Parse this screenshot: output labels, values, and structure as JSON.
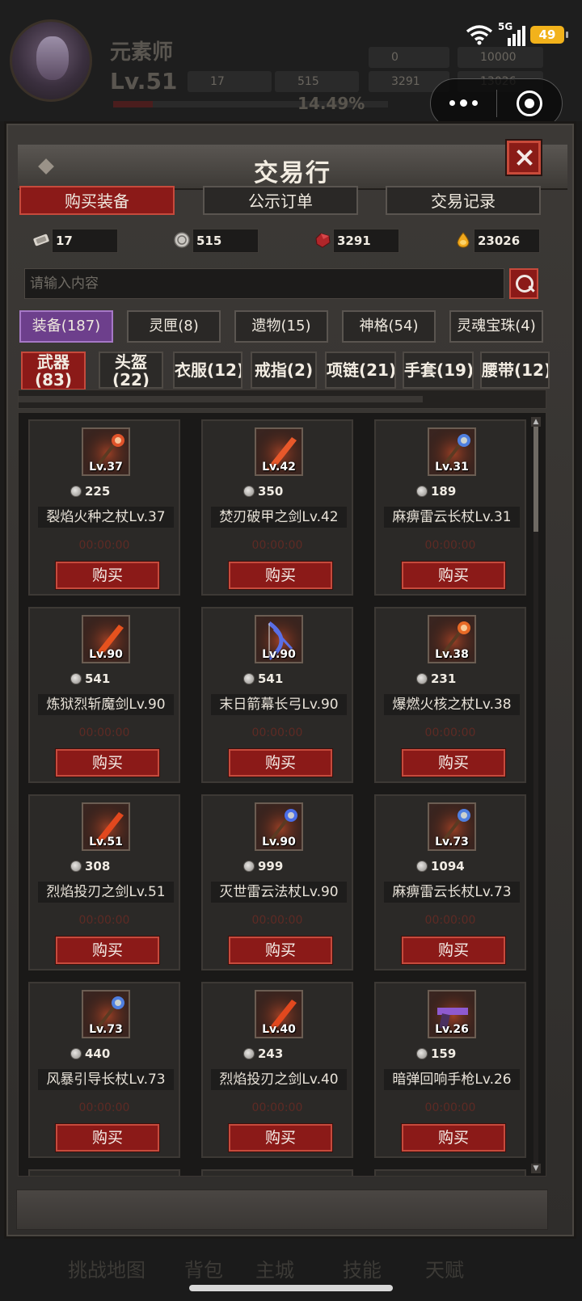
{
  "background_hud": {
    "player_name": "元素师",
    "level": "Lv.51",
    "stat_tickets": "17",
    "stat_silver": "515",
    "stat_red_a": "0",
    "stat_red_b": "3291",
    "stat_gold_a": "10000",
    "stat_gold_b": "13026",
    "exp_percent": "14.49%",
    "exp_fraction": 0.1449,
    "bottom_nav": [
      "挑战地图",
      "背包",
      "主城",
      "技能",
      "天赋"
    ]
  },
  "status_bar": {
    "network": "5G",
    "battery": "49"
  },
  "panel": {
    "title": "交易行",
    "tabs": [
      {
        "label": "购买装备",
        "active": true
      },
      {
        "label": "公示订单",
        "active": false
      },
      {
        "label": "交易记录",
        "active": false
      }
    ],
    "currencies": [
      {
        "icon": "ticket-icon",
        "value": "17"
      },
      {
        "icon": "silver-coin-icon",
        "value": "515"
      },
      {
        "icon": "red-crystal-icon",
        "value": "3291"
      },
      {
        "icon": "gold-ingot-icon",
        "value": "23026"
      }
    ],
    "search": {
      "placeholder": "请输入内容"
    },
    "categories": [
      {
        "label": "装备(187)",
        "active": true
      },
      {
        "label": "灵匣(8)",
        "active": false
      },
      {
        "label": "遗物(15)",
        "active": false
      },
      {
        "label": "神格(54)",
        "active": false
      },
      {
        "label": "灵魂宝珠(4)",
        "active": false
      }
    ],
    "subcategories": [
      {
        "line1": "武器",
        "line2": "(83)",
        "active": true
      },
      {
        "line1": "头盔",
        "line2": "(22)",
        "active": false
      },
      {
        "line1": "衣服(12)",
        "line2": "",
        "active": false
      },
      {
        "line1": "戒指(2)",
        "line2": "",
        "active": false
      },
      {
        "line1": "项链(21)",
        "line2": "",
        "active": false
      },
      {
        "line1": "手套(19)",
        "line2": "",
        "active": false
      },
      {
        "line1": "腰带(12)",
        "line2": "",
        "active": false
      }
    ],
    "buy_label": "购买",
    "items": [
      {
        "level": "Lv.37",
        "price": "225",
        "name": "裂焰火种之杖Lv.37",
        "timer": "00:00:00",
        "icon": "fire-staff-icon",
        "color": "#e0532a"
      },
      {
        "level": "Lv.42",
        "price": "350",
        "name": "焚刃破甲之剑Lv.42",
        "timer": "00:00:00",
        "icon": "fire-blade-icon",
        "color": "#e8582a"
      },
      {
        "level": "Lv.31",
        "price": "189",
        "name": "麻痹雷云长杖Lv.31",
        "timer": "00:00:00",
        "icon": "thunder-staff-icon",
        "color": "#4f7fe0"
      },
      {
        "level": "Lv.90",
        "price": "541",
        "name": "炼狱烈斩魔剑Lv.90",
        "timer": "00:00:00",
        "icon": "inferno-sword-icon",
        "color": "#e6521e"
      },
      {
        "level": "Lv.90",
        "price": "541",
        "name": "末日箭幕长弓Lv.90",
        "timer": "00:00:00",
        "icon": "doom-bow-icon",
        "color": "#5a6fe6"
      },
      {
        "level": "Lv.38",
        "price": "231",
        "name": "爆燃火核之杖Lv.38",
        "timer": "00:00:00",
        "icon": "fire-core-staff-icon",
        "color": "#e86a26"
      },
      {
        "level": "Lv.51",
        "price": "308",
        "name": "烈焰投刃之剑Lv.51",
        "timer": "00:00:00",
        "icon": "flame-sword-icon",
        "color": "#e2481e"
      },
      {
        "level": "Lv.90",
        "price": "999",
        "name": "灭世雷云法杖Lv.90",
        "timer": "00:00:00",
        "icon": "thunder-staff-icon",
        "color": "#4a6de8"
      },
      {
        "level": "Lv.73",
        "price": "1094",
        "name": "麻痹雷云长杖Lv.73",
        "timer": "00:00:00",
        "icon": "thunder-staff-icon",
        "color": "#4f7fe0"
      },
      {
        "level": "Lv.73",
        "price": "440",
        "name": "风暴引导长杖Lv.73",
        "timer": "00:00:00",
        "icon": "storm-staff-icon",
        "color": "#4f7fe0"
      },
      {
        "level": "Lv.40",
        "price": "243",
        "name": "烈焰投刃之剑Lv.40",
        "timer": "00:00:00",
        "icon": "flame-sword-icon",
        "color": "#e2481e"
      },
      {
        "level": "Lv.26",
        "price": "159",
        "name": "暗弹回响手枪Lv.26",
        "timer": "00:00:00",
        "icon": "shadow-pistol-icon",
        "color": "#8e5ad0"
      }
    ]
  }
}
